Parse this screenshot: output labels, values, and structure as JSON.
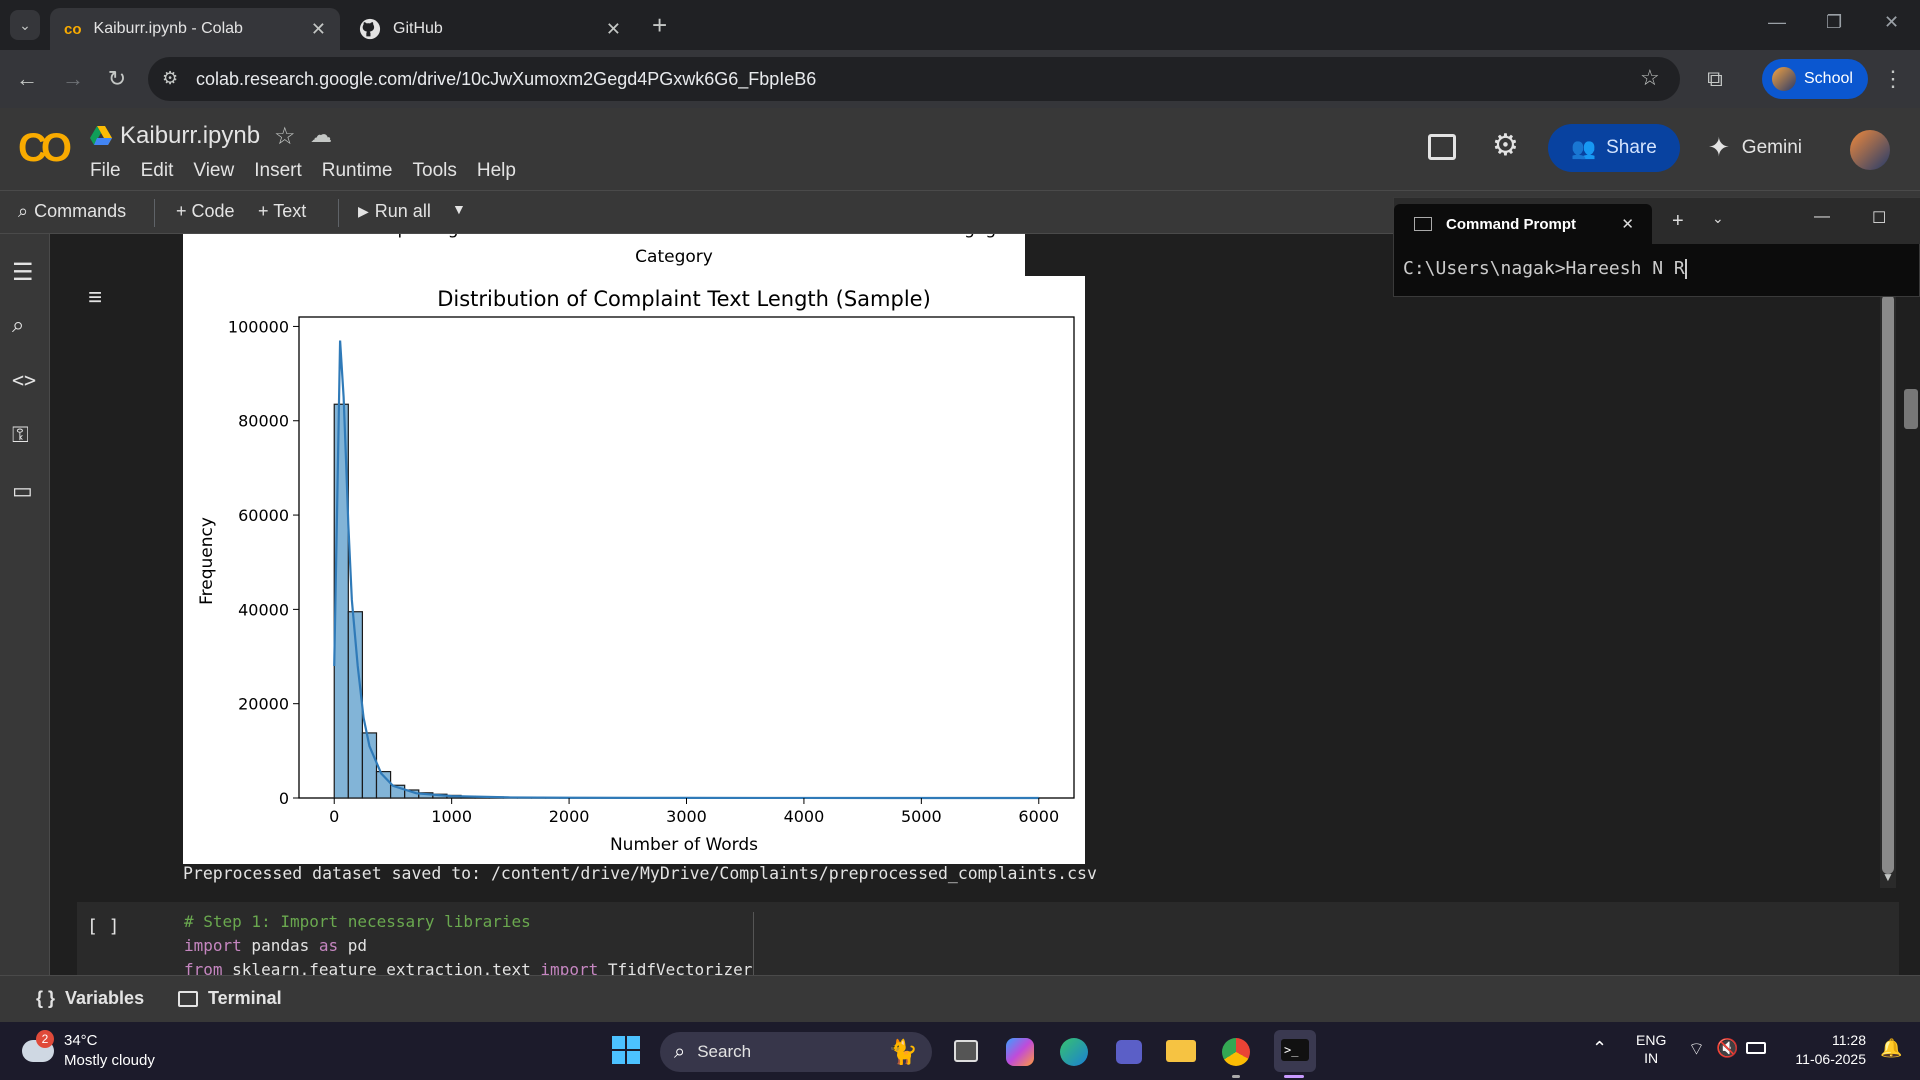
{
  "browser": {
    "tabs": [
      {
        "title": "Kaiburr.ipynb - Colab",
        "active": true
      },
      {
        "title": "GitHub",
        "active": false
      }
    ],
    "url": "colab.research.google.com/drive/10cJwXumoxm2Gegd4PGxwk6G6_FbpIeB6",
    "profile_label": "School"
  },
  "colab": {
    "notebook_title": "Kaiburr.ipynb",
    "menu": [
      "File",
      "Edit",
      "View",
      "Insert",
      "Runtime",
      "Tools",
      "Help"
    ],
    "share_label": "Share",
    "gemini_label": "Gemini",
    "commands_label": "Commands",
    "add_code_label": "+ Code",
    "add_text_label": "+ Text",
    "run_all_label": "Run all",
    "variables_label": "Variables",
    "terminal_label": "Terminal"
  },
  "prev_plot": {
    "cut_tick_labels": [
      "Credit Reporting",
      "Debt Collection",
      "Consumer Loan",
      "Mortgage"
    ],
    "xlabel": "Category"
  },
  "chart_data": {
    "type": "bar",
    "title": "Distribution of Complaint Text Length (Sample)",
    "xlabel": "Number of Words",
    "ylabel": "Frequency",
    "xlim": [
      -300,
      6300
    ],
    "ylim": [
      0,
      102000
    ],
    "xticks": [
      0,
      1000,
      2000,
      3000,
      4000,
      5000,
      6000
    ],
    "yticks": [
      0,
      20000,
      40000,
      60000,
      80000,
      100000
    ],
    "bin_width": 120,
    "bin_start": 0,
    "values": [
      83500,
      39500,
      13800,
      5600,
      2700,
      1700,
      1100,
      800,
      550,
      400,
      300,
      220,
      170,
      130,
      100,
      80,
      60,
      50,
      40,
      35,
      30,
      25,
      20,
      18,
      15,
      12,
      10,
      9,
      8,
      7,
      6,
      5,
      5,
      4,
      4,
      3,
      3,
      3,
      2,
      2,
      2,
      2,
      2,
      1,
      1,
      1,
      1,
      1,
      1,
      1
    ],
    "kde": {
      "x": [
        0,
        25,
        50,
        80,
        100,
        120,
        150,
        200,
        250,
        300,
        400,
        500,
        700,
        1000,
        1500,
        2000,
        3000,
        4000,
        5000,
        6000
      ],
      "y": [
        28000,
        62000,
        97000,
        85000,
        72000,
        58000,
        42000,
        28000,
        17000,
        11000,
        5200,
        2600,
        1000,
        400,
        120,
        50,
        20,
        10,
        5,
        0
      ]
    },
    "grid": false
  },
  "output_text": "Preprocessed dataset saved to: /content/drive/MyDrive/Complaints/preprocessed_complaints.csv",
  "code_cell": {
    "bracket": "[ ]",
    "lines": [
      {
        "text": "# Step 1: Import necessary libraries",
        "kind": "comment"
      },
      {
        "kw1": "import",
        "mid": " pandas ",
        "kw2": "as",
        "tail": " pd",
        "kind": "import"
      },
      {
        "kw1": "from",
        "mid": " sklearn.feature_extraction.text ",
        "kw2": "import",
        "tail": " TfidfVectorizer",
        "kind": "import"
      }
    ]
  },
  "cmd": {
    "title": "Command Prompt",
    "line": "C:\\Users\\nagak>Hareesh N R"
  },
  "taskbar": {
    "weather_temp": "34°C",
    "weather_desc": "Mostly cloudy",
    "weather_badge": "2",
    "search_label": "Search",
    "lang1": "ENG",
    "lang2": "IN",
    "time": "11:28",
    "date": "11-06-2025"
  },
  "colors": {
    "accent": "#0b57d0",
    "share_bg": "#0842a0",
    "bar_fill": "#82b4d7",
    "kde": "#2f7ab8"
  }
}
